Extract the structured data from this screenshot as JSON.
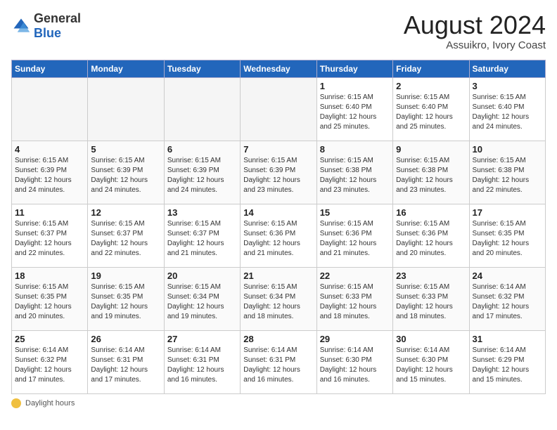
{
  "logo": {
    "general": "General",
    "blue": "Blue"
  },
  "title": {
    "month_year": "August 2024",
    "location": "Assuikro, Ivory Coast"
  },
  "days_of_week": [
    "Sunday",
    "Monday",
    "Tuesday",
    "Wednesday",
    "Thursday",
    "Friday",
    "Saturday"
  ],
  "weeks": [
    [
      {
        "day": "",
        "empty": true
      },
      {
        "day": "",
        "empty": true
      },
      {
        "day": "",
        "empty": true
      },
      {
        "day": "",
        "empty": true
      },
      {
        "day": "1",
        "sunrise": "6:15 AM",
        "sunset": "6:40 PM",
        "daylight": "12 hours and 25 minutes."
      },
      {
        "day": "2",
        "sunrise": "6:15 AM",
        "sunset": "6:40 PM",
        "daylight": "12 hours and 25 minutes."
      },
      {
        "day": "3",
        "sunrise": "6:15 AM",
        "sunset": "6:40 PM",
        "daylight": "12 hours and 24 minutes."
      }
    ],
    [
      {
        "day": "4",
        "sunrise": "6:15 AM",
        "sunset": "6:39 PM",
        "daylight": "12 hours and 24 minutes."
      },
      {
        "day": "5",
        "sunrise": "6:15 AM",
        "sunset": "6:39 PM",
        "daylight": "12 hours and 24 minutes."
      },
      {
        "day": "6",
        "sunrise": "6:15 AM",
        "sunset": "6:39 PM",
        "daylight": "12 hours and 24 minutes."
      },
      {
        "day": "7",
        "sunrise": "6:15 AM",
        "sunset": "6:39 PM",
        "daylight": "12 hours and 23 minutes."
      },
      {
        "day": "8",
        "sunrise": "6:15 AM",
        "sunset": "6:38 PM",
        "daylight": "12 hours and 23 minutes."
      },
      {
        "day": "9",
        "sunrise": "6:15 AM",
        "sunset": "6:38 PM",
        "daylight": "12 hours and 23 minutes."
      },
      {
        "day": "10",
        "sunrise": "6:15 AM",
        "sunset": "6:38 PM",
        "daylight": "12 hours and 22 minutes."
      }
    ],
    [
      {
        "day": "11",
        "sunrise": "6:15 AM",
        "sunset": "6:37 PM",
        "daylight": "12 hours and 22 minutes."
      },
      {
        "day": "12",
        "sunrise": "6:15 AM",
        "sunset": "6:37 PM",
        "daylight": "12 hours and 22 minutes."
      },
      {
        "day": "13",
        "sunrise": "6:15 AM",
        "sunset": "6:37 PM",
        "daylight": "12 hours and 21 minutes."
      },
      {
        "day": "14",
        "sunrise": "6:15 AM",
        "sunset": "6:36 PM",
        "daylight": "12 hours and 21 minutes."
      },
      {
        "day": "15",
        "sunrise": "6:15 AM",
        "sunset": "6:36 PM",
        "daylight": "12 hours and 21 minutes."
      },
      {
        "day": "16",
        "sunrise": "6:15 AM",
        "sunset": "6:36 PM",
        "daylight": "12 hours and 20 minutes."
      },
      {
        "day": "17",
        "sunrise": "6:15 AM",
        "sunset": "6:35 PM",
        "daylight": "12 hours and 20 minutes."
      }
    ],
    [
      {
        "day": "18",
        "sunrise": "6:15 AM",
        "sunset": "6:35 PM",
        "daylight": "12 hours and 20 minutes."
      },
      {
        "day": "19",
        "sunrise": "6:15 AM",
        "sunset": "6:35 PM",
        "daylight": "12 hours and 19 minutes."
      },
      {
        "day": "20",
        "sunrise": "6:15 AM",
        "sunset": "6:34 PM",
        "daylight": "12 hours and 19 minutes."
      },
      {
        "day": "21",
        "sunrise": "6:15 AM",
        "sunset": "6:34 PM",
        "daylight": "12 hours and 18 minutes."
      },
      {
        "day": "22",
        "sunrise": "6:15 AM",
        "sunset": "6:33 PM",
        "daylight": "12 hours and 18 minutes."
      },
      {
        "day": "23",
        "sunrise": "6:15 AM",
        "sunset": "6:33 PM",
        "daylight": "12 hours and 18 minutes."
      },
      {
        "day": "24",
        "sunrise": "6:14 AM",
        "sunset": "6:32 PM",
        "daylight": "12 hours and 17 minutes."
      }
    ],
    [
      {
        "day": "25",
        "sunrise": "6:14 AM",
        "sunset": "6:32 PM",
        "daylight": "12 hours and 17 minutes."
      },
      {
        "day": "26",
        "sunrise": "6:14 AM",
        "sunset": "6:31 PM",
        "daylight": "12 hours and 17 minutes."
      },
      {
        "day": "27",
        "sunrise": "6:14 AM",
        "sunset": "6:31 PM",
        "daylight": "12 hours and 16 minutes."
      },
      {
        "day": "28",
        "sunrise": "6:14 AM",
        "sunset": "6:31 PM",
        "daylight": "12 hours and 16 minutes."
      },
      {
        "day": "29",
        "sunrise": "6:14 AM",
        "sunset": "6:30 PM",
        "daylight": "12 hours and 16 minutes."
      },
      {
        "day": "30",
        "sunrise": "6:14 AM",
        "sunset": "6:30 PM",
        "daylight": "12 hours and 15 minutes."
      },
      {
        "day": "31",
        "sunrise": "6:14 AM",
        "sunset": "6:29 PM",
        "daylight": "12 hours and 15 minutes."
      }
    ]
  ],
  "footer": {
    "daylight_label": "Daylight hours"
  }
}
